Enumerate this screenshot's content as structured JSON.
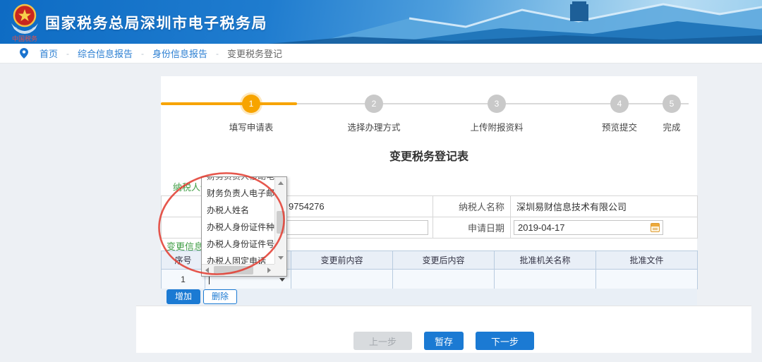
{
  "header": {
    "title": "国家税务总局深圳市电子税务局",
    "logo_caption": "中国税务"
  },
  "breadcrumb": {
    "separator": "-",
    "items": [
      "首页",
      "综合信息报告",
      "身份信息报告",
      "变更税务登记"
    ]
  },
  "stepper": {
    "steps": [
      {
        "num": "1",
        "label": "填写申请表"
      },
      {
        "num": "2",
        "label": "选择办理方式"
      },
      {
        "num": "3",
        "label": "上传附报资料"
      },
      {
        "num": "4",
        "label": "预览提交"
      },
      {
        "num": "5",
        "label": "完成"
      }
    ]
  },
  "form": {
    "title": "变更税务登记表",
    "section1_label": "纳税人信息",
    "section2_label": "变更信息",
    "taxpayer_id_value": "9754276",
    "taxpayer_name_label": "纳税人名称",
    "taxpayer_name_value": "深圳易财信息技术有限公司",
    "apply_date_label": "申请日期",
    "apply_date_value": "2019-04-17"
  },
  "dropdown": {
    "items": [
      "财务负责人移动电话",
      "财务负责人电子邮箱",
      "办税人姓名",
      "办税人身份证件种类",
      "办税人身份证件号码",
      "办税人固定电话"
    ]
  },
  "table": {
    "headers": [
      "序号",
      "变更前内容",
      "变更后内容",
      "批准机关名称",
      "批准文件"
    ],
    "rows": [
      {
        "index": "1"
      }
    ]
  },
  "table_buttons": {
    "add": "增加",
    "delete": "删除"
  },
  "footer_buttons": {
    "prev": "上一步",
    "save": "暂存",
    "next": "下一步"
  },
  "colors": {
    "banner_blue": "#1272c9",
    "accent_blue": "#1b7ad3",
    "step_active_orange": "#f7a400",
    "section_green": "#3f9d44",
    "annotation_red": "#e23a2e"
  }
}
